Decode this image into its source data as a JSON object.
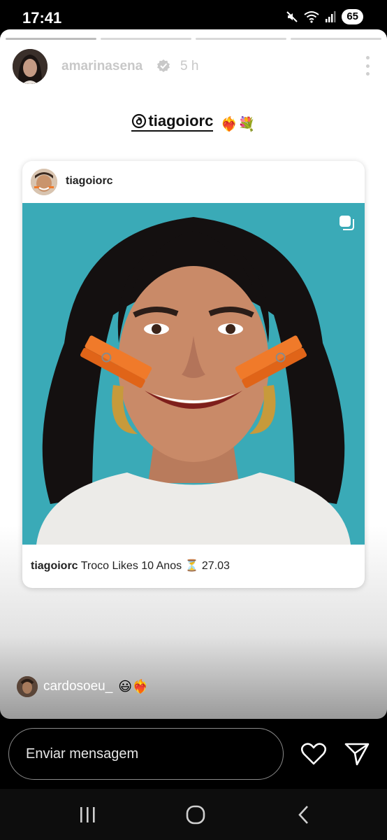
{
  "status_bar": {
    "time": "17:41",
    "battery": "65"
  },
  "story": {
    "progress_segments": 4,
    "progress_completed": 0.25,
    "username": "amarinasena",
    "time_ago": "5 h",
    "mention": "tiagoiorc",
    "mention_emoji": "❤️‍🔥💐"
  },
  "post": {
    "username": "tiagoiorc",
    "caption_username": "tiagoiorc",
    "caption_text": "Troco Likes 10 Anos ⏳ 27.03"
  },
  "viewer": {
    "name": "cardosoeu_",
    "emoji": "😃❤️‍🔥"
  },
  "reply_bar": {
    "placeholder": "Enviar mensagem"
  },
  "colors": {
    "post_bg": "#3aaab7",
    "background": "#000000"
  },
  "icons": [
    "mute-icon",
    "wifi-icon",
    "signal-icon",
    "verified-icon",
    "more-icon",
    "threads-icon",
    "carousel-icon",
    "heart-icon",
    "send-icon",
    "recents-icon",
    "home-icon",
    "back-icon"
  ]
}
